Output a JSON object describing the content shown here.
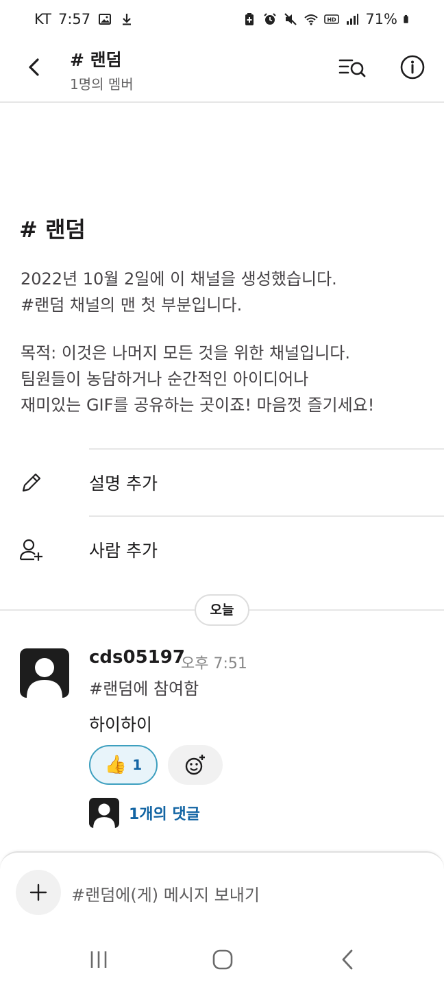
{
  "status_bar": {
    "carrier": "KT",
    "time": "7:57",
    "battery": "71%",
    "icons_left": [
      "image-icon",
      "download-icon"
    ],
    "icons_right": [
      "battery-saver-icon",
      "alarm-icon",
      "mute-icon",
      "wifi-icon",
      "hd-icon",
      "signal-icon",
      "battery-icon"
    ]
  },
  "header": {
    "title": "# 랜덤",
    "subtitle": "1명의 멤버"
  },
  "intro": {
    "title": "# 랜덤",
    "created_line1": "2022년 10월 2일에 이 채널을 생성했습니다.",
    "created_line2": "#랜덤 채널의 맨 첫 부분입니다.",
    "purpose_line1": "목적: 이것은 나머지 모든 것을 위한 채널입니다.",
    "purpose_line2": "팀원들이 농담하거나 순간적인 아이디어나",
    "purpose_line3": "재미있는 GIF를 공유하는 곳이죠! 마음껏 즐기세요!"
  },
  "actions": [
    {
      "label": "설명 추가",
      "icon": "pencil-icon"
    },
    {
      "label": "사람 추가",
      "icon": "add-person-icon"
    }
  ],
  "date_divider": "오늘",
  "message": {
    "user": "cds05197",
    "time": "오후 7:51",
    "joined": "#랜덤에 참여함",
    "body": "하이하이",
    "reaction": {
      "emoji": "👍",
      "count": "1"
    },
    "replies": "1개의 댓글"
  },
  "composer": {
    "placeholder": "#랜덤에(게) 메시지 보내기"
  },
  "colors": {
    "link": "#1264a3",
    "reaction_border": "#3d9fbf",
    "reaction_bg": "#e8f4fa",
    "text": "#1d1c1d",
    "muted": "#616061"
  }
}
